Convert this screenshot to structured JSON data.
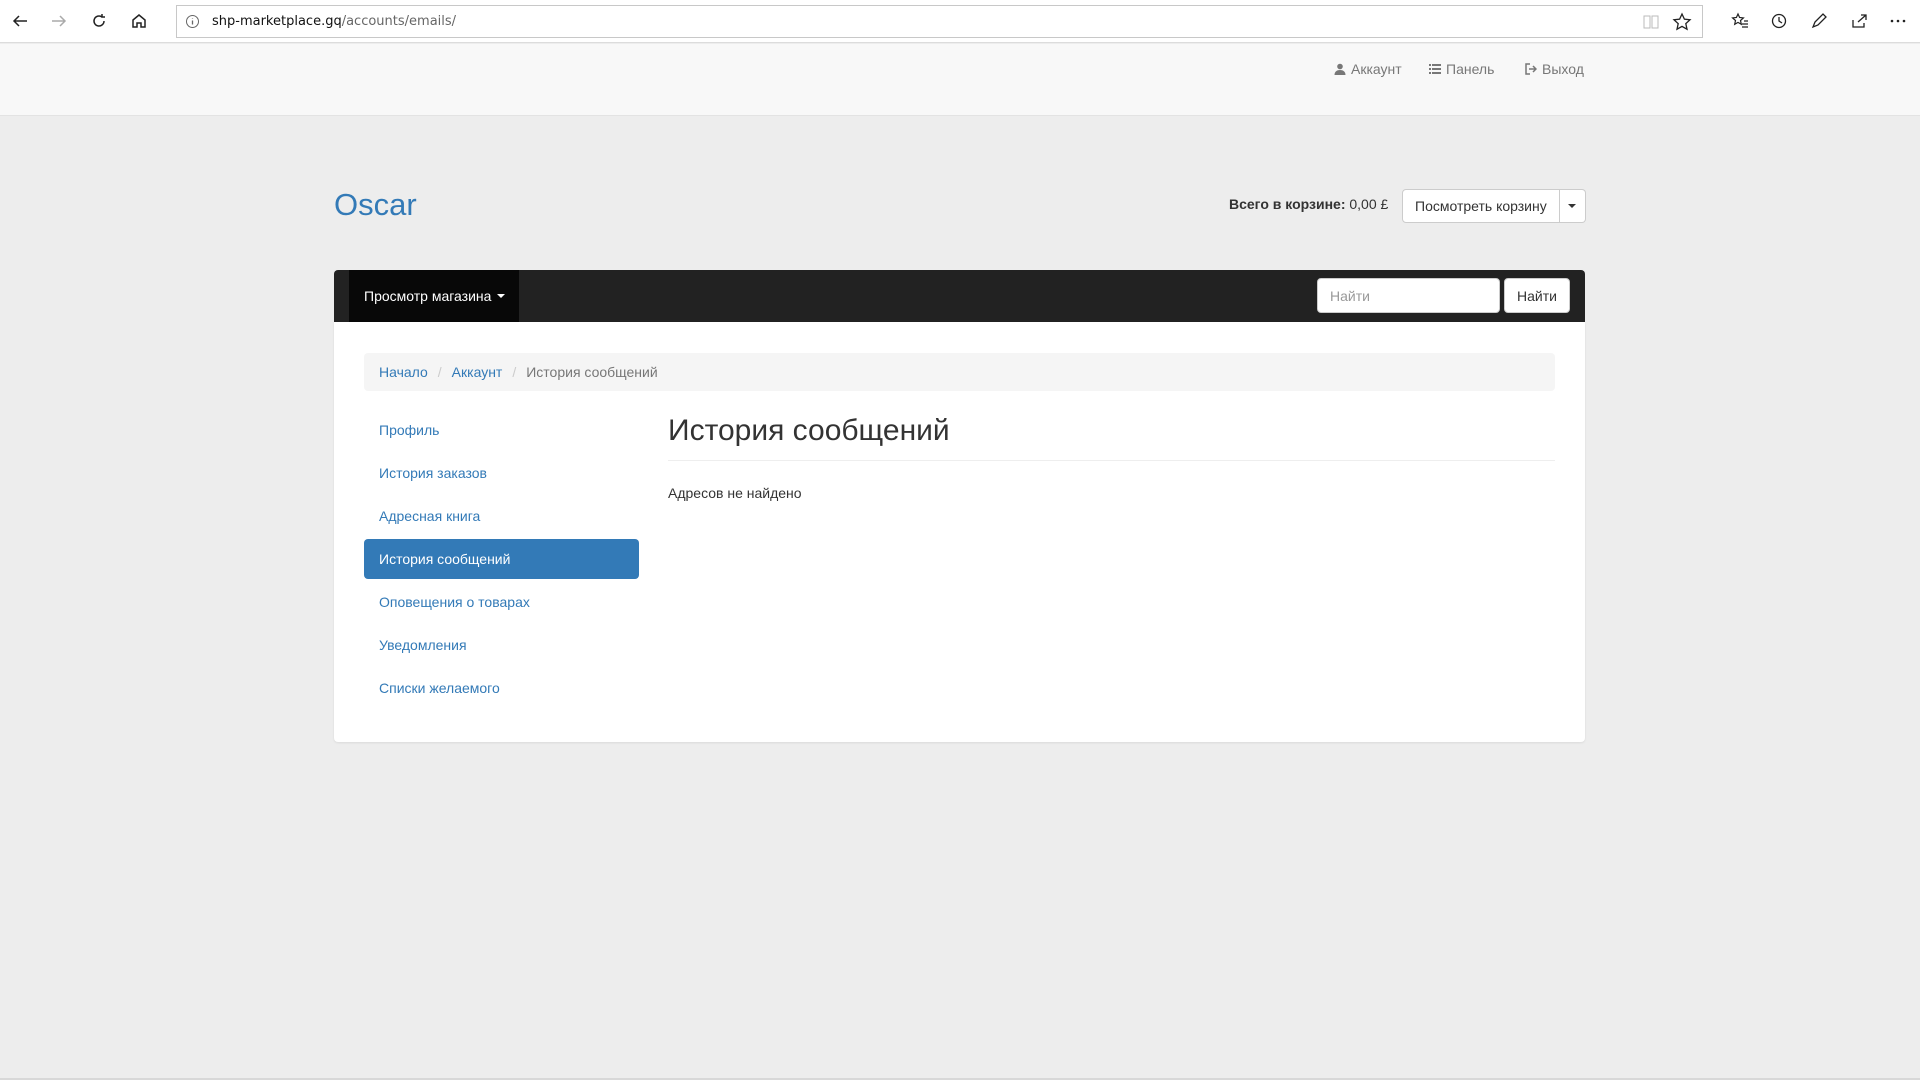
{
  "browser": {
    "url_host": "shp-marketplace.gq",
    "url_path": "/accounts/emails/",
    "nav_icons": [
      "back-icon",
      "forward-icon",
      "refresh-icon",
      "home-icon"
    ],
    "toolbar_icons": [
      "favorites-icon",
      "history-icon",
      "pen-icon",
      "share-icon",
      "more-icon"
    ]
  },
  "topbar": {
    "account": "Аккаунт",
    "dashboard": "Панель",
    "logout": "Выход"
  },
  "header": {
    "brand": "Oscar",
    "basket_label": "Всего в корзине:",
    "basket_total": "0,00 £",
    "view_basket": "Посмотреть корзину"
  },
  "navbar": {
    "browse_store": "Просмотр магазина",
    "search_placeholder": "Найти",
    "search_button": "Найти"
  },
  "breadcrumb": {
    "home": "Начало",
    "account": "Аккаунт",
    "current": "История сообщений"
  },
  "sidebar": {
    "items": [
      {
        "label": "Профиль",
        "active": false
      },
      {
        "label": "История заказов",
        "active": false
      },
      {
        "label": "Адресная книга",
        "active": false
      },
      {
        "label": "История сообщений",
        "active": true
      },
      {
        "label": "Оповещения о товарах",
        "active": false
      },
      {
        "label": "Уведомления",
        "active": false
      },
      {
        "label": "Списки желаемого",
        "active": false
      }
    ]
  },
  "main": {
    "title": "История сообщений",
    "empty_message": "Адресов не найдено"
  },
  "colors": {
    "link": "#337ab7",
    "navbar": "#222222",
    "background": "#ededed"
  }
}
